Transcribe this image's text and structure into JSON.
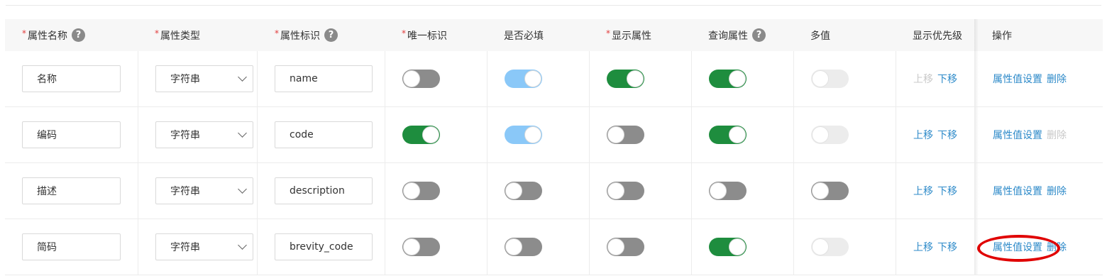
{
  "headers": {
    "name": "属性名称",
    "type": "属性类型",
    "key": "属性标识",
    "unique": "唯一标识",
    "required": "是否必填",
    "display": "显示属性",
    "query": "查询属性",
    "multi": "多值",
    "priority": "显示优先级",
    "ops": "操作"
  },
  "required_mark": "*",
  "help_mark": "?",
  "actions": {
    "up": "上移",
    "down": "下移",
    "settings": "属性值设置",
    "delete": "删除"
  },
  "colors": {
    "switch_on": "#1e8d3e",
    "switch_on_disabled": "#8ac8f8",
    "switch_off": "#8c8c8c",
    "link": "#2d8ac9",
    "highlight": "#e00000"
  },
  "rows": [
    {
      "name": "名称",
      "type": "字符串",
      "key": "name",
      "unique": "off",
      "required": "on-disabled",
      "display": "on",
      "query": "on",
      "multi": "disabled",
      "up_enabled": false,
      "down_enabled": true,
      "delete_enabled": true
    },
    {
      "name": "编码",
      "type": "字符串",
      "key": "code",
      "unique": "on",
      "required": "on-disabled",
      "display": "off",
      "query": "on",
      "multi": "disabled",
      "up_enabled": true,
      "down_enabled": true,
      "delete_enabled": false
    },
    {
      "name": "描述",
      "type": "字符串",
      "key": "description",
      "unique": "off",
      "required": "off",
      "display": "off",
      "query": "off",
      "multi": "off",
      "up_enabled": true,
      "down_enabled": true,
      "delete_enabled": true
    },
    {
      "name": "简码",
      "type": "字符串",
      "key": "brevity_code",
      "unique": "off",
      "required": "off",
      "display": "off",
      "query": "on",
      "multi": "disabled",
      "up_enabled": true,
      "down_enabled": true,
      "delete_enabled": true
    }
  ]
}
